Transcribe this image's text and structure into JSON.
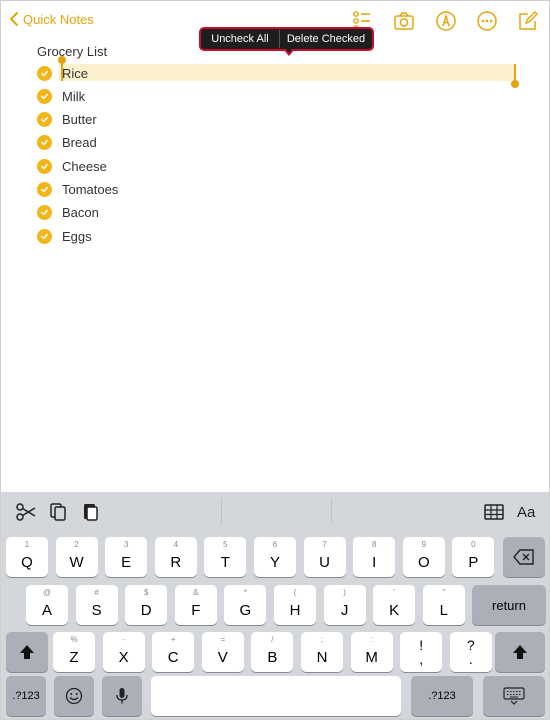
{
  "header": {
    "back_label": "Quick Notes",
    "accent_color": "#e5a50a",
    "icons": [
      "checklist-icon",
      "camera-icon",
      "markup-icon",
      "more-icon",
      "compose-icon"
    ]
  },
  "context_menu": {
    "uncheck_all": "Uncheck All",
    "delete_checked": "Delete Checked",
    "highlight_border_color": "#c8102e"
  },
  "note": {
    "title": "Grocery List",
    "items": [
      {
        "label": "Rice",
        "checked": true
      },
      {
        "label": "Milk",
        "checked": true
      },
      {
        "label": "Butter",
        "checked": true
      },
      {
        "label": "Bread",
        "checked": true
      },
      {
        "label": "Cheese",
        "checked": true
      },
      {
        "label": "Tomatoes",
        "checked": true
      },
      {
        "label": "Bacon",
        "checked": true
      },
      {
        "label": "Eggs",
        "checked": true
      }
    ],
    "check_color": "#f2b618"
  },
  "keyboard": {
    "toolbar_icons": [
      "scissors-icon",
      "copy-icon",
      "paste-icon",
      "table-icon"
    ],
    "format_label": "Aa",
    "row1": [
      {
        "main": "Q",
        "sec": "1"
      },
      {
        "main": "W",
        "sec": "2"
      },
      {
        "main": "E",
        "sec": "3"
      },
      {
        "main": "R",
        "sec": "4"
      },
      {
        "main": "T",
        "sec": "5"
      },
      {
        "main": "Y",
        "sec": "6"
      },
      {
        "main": "U",
        "sec": "7"
      },
      {
        "main": "I",
        "sec": "8"
      },
      {
        "main": "O",
        "sec": "9"
      },
      {
        "main": "P",
        "sec": "0"
      }
    ],
    "row2": [
      {
        "main": "A",
        "sec": "@"
      },
      {
        "main": "S",
        "sec": "#"
      },
      {
        "main": "D",
        "sec": "$"
      },
      {
        "main": "F",
        "sec": "&"
      },
      {
        "main": "G",
        "sec": "*"
      },
      {
        "main": "H",
        "sec": "("
      },
      {
        "main": "J",
        "sec": ")"
      },
      {
        "main": "K",
        "sec": "'"
      },
      {
        "main": "L",
        "sec": "\""
      }
    ],
    "row3": [
      {
        "main": "Z",
        "sec": "%"
      },
      {
        "main": "X",
        "sec": "-"
      },
      {
        "main": "C",
        "sec": "+"
      },
      {
        "main": "V",
        "sec": "="
      },
      {
        "main": "B",
        "sec": "/"
      },
      {
        "main": "N",
        "sec": ";"
      },
      {
        "main": "M",
        "sec": ":"
      }
    ],
    "punct1": {
      "top": "!",
      "bottom": ","
    },
    "punct2": {
      "top": "?",
      "bottom": "."
    },
    "return_label": "return",
    "numbers_label": ".?123",
    "numbers_label_right": ".?123"
  }
}
